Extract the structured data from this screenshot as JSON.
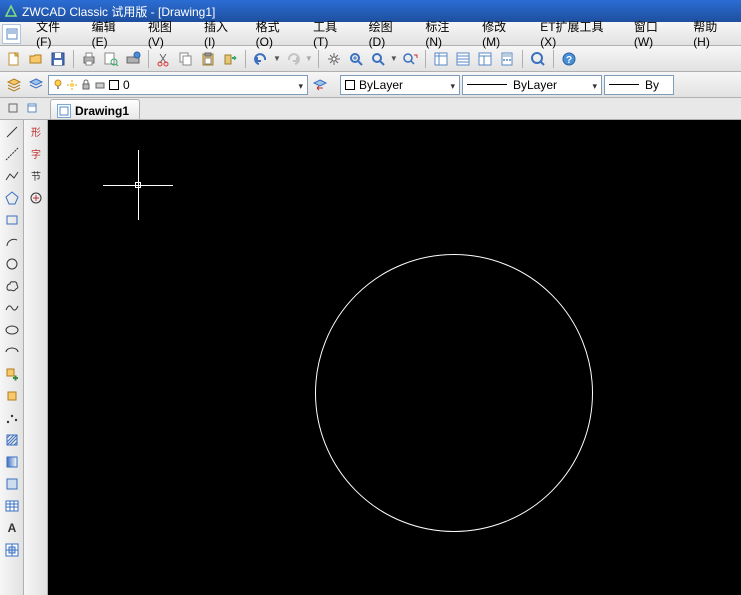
{
  "titlebar": {
    "text": "ZWCAD Classic 试用版 - [Drawing1]"
  },
  "menu": {
    "file": "文件(F)",
    "edit": "编辑(E)",
    "view": "视图(V)",
    "insert": "插入(I)",
    "format": "格式(O)",
    "tools": "工具(T)",
    "draw": "绘图(D)",
    "dim": "标注(N)",
    "modify": "修改(M)",
    "ettools": "ET扩展工具(X)",
    "window": "窗口(W)",
    "help": "帮助(H)"
  },
  "layer": {
    "current": "0"
  },
  "props": {
    "color": "ByLayer",
    "linetype": "ByLayer",
    "lineweight_partial": "By"
  },
  "tab": {
    "name": "Drawing1"
  }
}
